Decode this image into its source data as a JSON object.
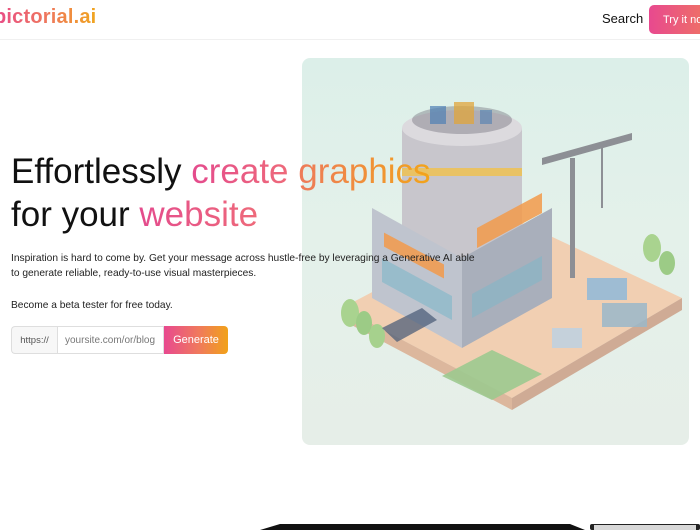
{
  "nav": {
    "logo": "pictorial.ai",
    "search_label": "Search",
    "cta_label": "Try it now"
  },
  "hero": {
    "heading_line1_plain": "Effortlessly ",
    "heading_line1_accent1": "create",
    "heading_line1_accent2": "graphics",
    "heading_line2_plain": "for your ",
    "heading_line2_accent": "website",
    "description": "Inspiration is hard to come by. Get your message across hustle-free by leveraging a Generative AI able to generate reliable, ready-to-use visual masterpieces.",
    "beta_text": "Become a beta tester for free today.",
    "url_prefix": "https://",
    "url_placeholder": "yoursite.com/or/blog",
    "generate_label": "Generate"
  },
  "colors": {
    "accent_pink": "#e8498f",
    "accent_coral": "#f07a5c",
    "accent_orange": "#f1a219"
  },
  "icons": {
    "hero_illustration": "isometric-building-illustration"
  }
}
